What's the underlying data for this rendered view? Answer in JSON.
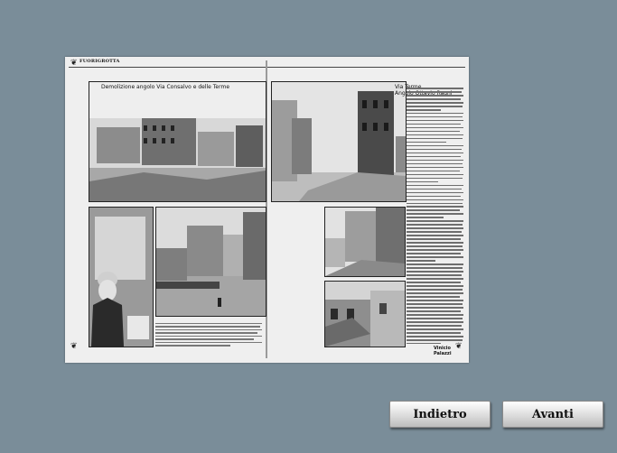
{
  "magazine": {
    "header": "FUORIGROTTA",
    "photo_captions": {
      "top_left": "Demolizione angolo Via Consalvo e delle Terme",
      "top_right_line1": "Via Terme",
      "top_right_line2": "Angolo Ottavio Ragni"
    },
    "author": "Vinicio Palazzi"
  },
  "navigation": {
    "back_label": "Indietro",
    "next_label": "Avanti"
  },
  "colors": {
    "background": "#7a8d99",
    "button_face": "#dcdcdc"
  }
}
